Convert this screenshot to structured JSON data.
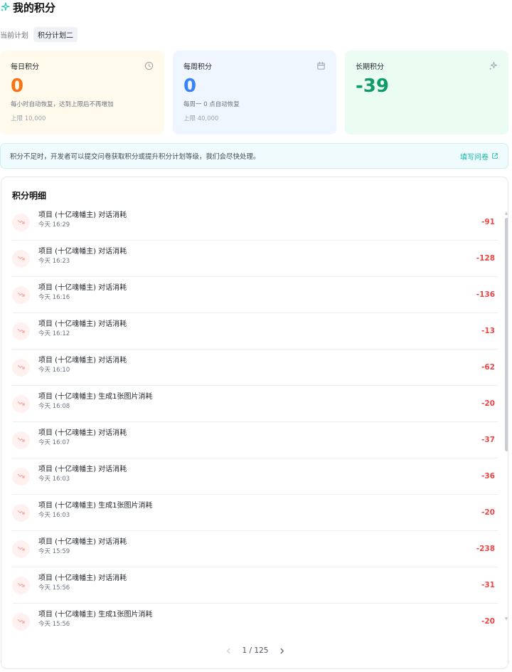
{
  "header": {
    "title": "我的积分"
  },
  "plan": {
    "label": "当前计划",
    "value": "积分计划二"
  },
  "cards": {
    "daily": {
      "name": "每日积分",
      "value": "0",
      "desc": "每小时自动恢复，达到上限后不再增加",
      "limit": "上限 10,000",
      "color": "#f97316"
    },
    "weekly": {
      "name": "每周积分",
      "value": "0",
      "desc": "每周一 0 点自动恢复",
      "limit": "上限 40,000",
      "color": "#3b82f6"
    },
    "long": {
      "name": "长期积分",
      "value": "-39",
      "color": "#0f9b6a"
    }
  },
  "notice": {
    "text": "积分不足时，开发者可以提交问卷获取积分或提升积分计划等级，我们会尽快处理。",
    "link": "填写问卷"
  },
  "details": {
    "title": "积分明细",
    "items": [
      {
        "desc": "项目 (十亿魂幡主) 对话消耗",
        "time": "今天 16:29",
        "amount": "-91"
      },
      {
        "desc": "项目 (十亿魂幡主) 对话消耗",
        "time": "今天 16:23",
        "amount": "-128"
      },
      {
        "desc": "项目 (十亿魂幡主) 对话消耗",
        "time": "今天 16:16",
        "amount": "-136"
      },
      {
        "desc": "项目 (十亿魂幡主) 对话消耗",
        "time": "今天 16:12",
        "amount": "-13"
      },
      {
        "desc": "项目 (十亿魂幡主) 对话消耗",
        "time": "今天 16:10",
        "amount": "-62"
      },
      {
        "desc": "项目 (十亿魂幡主) 生成1张图片消耗",
        "time": "今天 16:08",
        "amount": "-20"
      },
      {
        "desc": "项目 (十亿魂幡主) 对话消耗",
        "time": "今天 16:07",
        "amount": "-37"
      },
      {
        "desc": "项目 (十亿魂幡主) 对话消耗",
        "time": "今天 16:03",
        "amount": "-36"
      },
      {
        "desc": "项目 (十亿魂幡主) 生成1张图片消耗",
        "time": "今天 16:03",
        "amount": "-20"
      },
      {
        "desc": "项目 (十亿魂幡主) 对话消耗",
        "time": "今天 15:59",
        "amount": "-238"
      },
      {
        "desc": "项目 (十亿魂幡主) 对话消耗",
        "time": "今天 15:56",
        "amount": "-31"
      },
      {
        "desc": "项目 (十亿魂幡主) 生成1张图片消耗",
        "time": "今天 15:56",
        "amount": "-20"
      }
    ]
  },
  "pagination": {
    "text": "1 / 125"
  },
  "colors": {
    "negative": "#ef4444",
    "accent": "#14b8a6"
  },
  "icons": {
    "title": "sparkle-icon",
    "daily": "clock-icon",
    "weekly": "calendar-icon",
    "long": "sparkles-icon",
    "row": "trend-down-icon",
    "link": "external-link-icon"
  }
}
